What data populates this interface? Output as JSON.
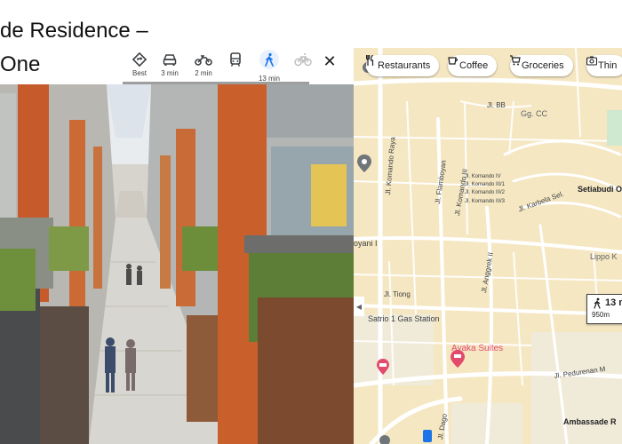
{
  "slide": {
    "title_line1": "de Residence –",
    "title_line2": "One"
  },
  "travel_modes": {
    "items": [
      {
        "key": "best",
        "label": "Best",
        "icon": "diamond-turn-icon"
      },
      {
        "key": "car",
        "label": "3 min",
        "icon": "car-icon"
      },
      {
        "key": "motorcycle",
        "label": "2 min",
        "icon": "motorcycle-icon"
      },
      {
        "key": "transit",
        "label": "",
        "icon": "train-icon"
      },
      {
        "key": "walk",
        "label": "13 min",
        "icon": "walk-icon"
      },
      {
        "key": "bike",
        "label": "",
        "icon": "bicycle-icon"
      }
    ],
    "active": "walk",
    "close_symbol": "✕"
  },
  "map": {
    "chips": [
      {
        "label": "Restaurants",
        "icon": "fork-knife-icon"
      },
      {
        "label": "Coffee",
        "icon": "coffee-cup-icon"
      },
      {
        "label": "Groceries",
        "icon": "cart-icon"
      },
      {
        "label": "Thin",
        "icon": "camera-icon"
      }
    ],
    "labels": {
      "jl_bb": "Jl. BB",
      "gg_cc": "Gg. CC",
      "komando_raya": "Jl. Komando Raya",
      "flamboyan": "Jl. Flamboyan",
      "komando_iii": "Jl. Komando III",
      "komando_iv": "Jl. Komando IV",
      "komando_iii_1": "Jl. Komando III/1",
      "komando_iii_2": "Jl. Komando III/2",
      "komando_iii_3": "Jl. Komando III/3",
      "karbela": "Jl. Karbela Sel.",
      "setiabudi": "Setiabudi O",
      "oyani": "oyani I",
      "anggrek": "Jl. Anggrek II",
      "lippo": "Lippo K",
      "tiong": "Jl. Tiong",
      "gas_station": "Satrio 1 Gas Station",
      "ayaka": "Ayaka Suites",
      "pedurenan": "Jl. Pedurenan M",
      "dago": "Jl. Dago",
      "ambassade": "Ambassade R"
    },
    "route_box": {
      "time": "13 m",
      "distance": "950m"
    },
    "collapse_symbol": "◀",
    "colors": {
      "background": "#f1efe9",
      "block": "#f5e7c2",
      "road": "#ffffff",
      "park": "#cfe8d0",
      "route": "#1a73e8",
      "pin_gray": "#70757a",
      "pin_red": "#e24b6c"
    }
  }
}
